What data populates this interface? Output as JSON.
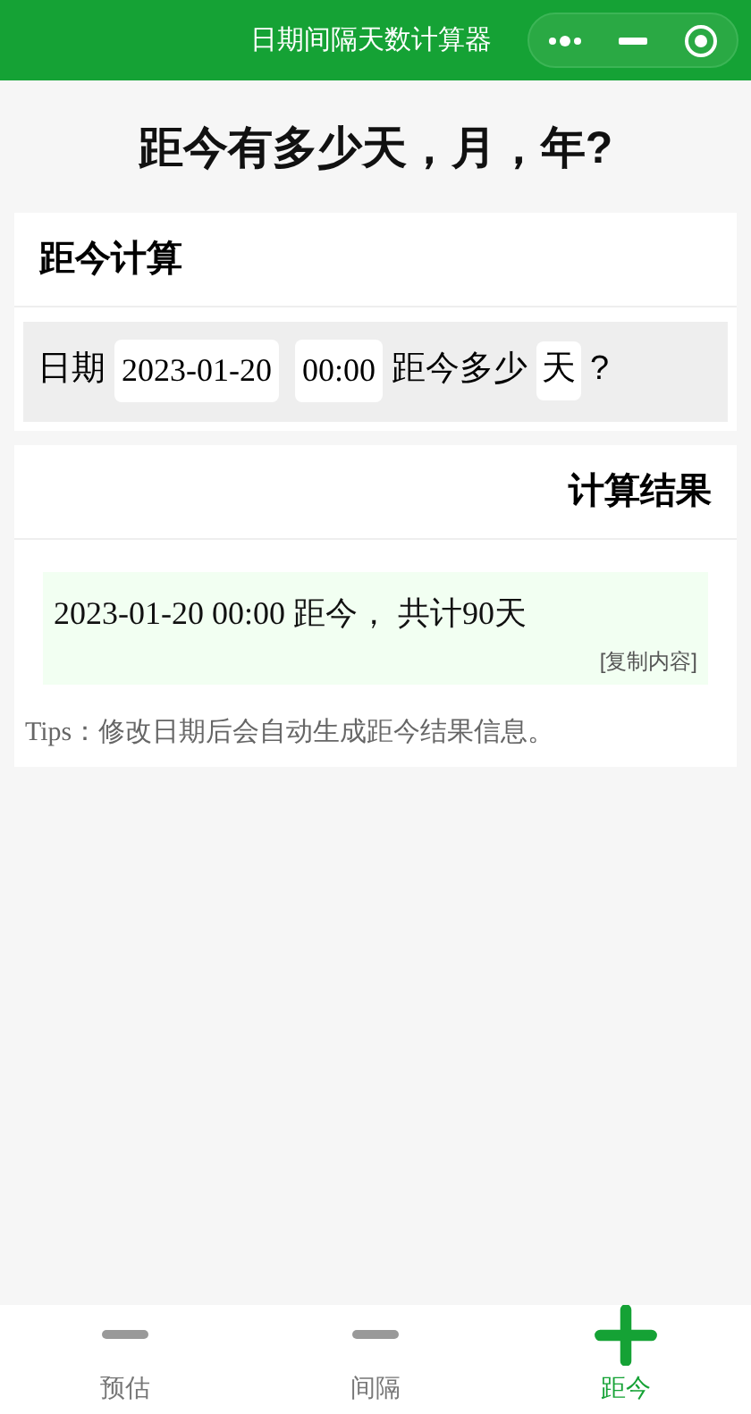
{
  "nav_bar": {
    "title": "日期间隔天数计算器"
  },
  "heading": "距今有多少天，月，年?",
  "calc_card": {
    "title": "距今计算",
    "date_label": "日期",
    "date_value": "2023-01-20",
    "time_value": "00:00",
    "middle_text": "距今多少",
    "unit_value": "天",
    "question": "?"
  },
  "result_card": {
    "title": "计算结果",
    "result_text": "2023-01-20 00:00 距今， 共计90天",
    "copy_link": "[复制内容]",
    "tips": "Tips：修改日期后会自动生成距今结果信息。"
  },
  "tab_bar": [
    {
      "label": "预估",
      "selected": false
    },
    {
      "label": "间隔",
      "selected": false
    },
    {
      "label": "距今",
      "selected": true
    }
  ]
}
